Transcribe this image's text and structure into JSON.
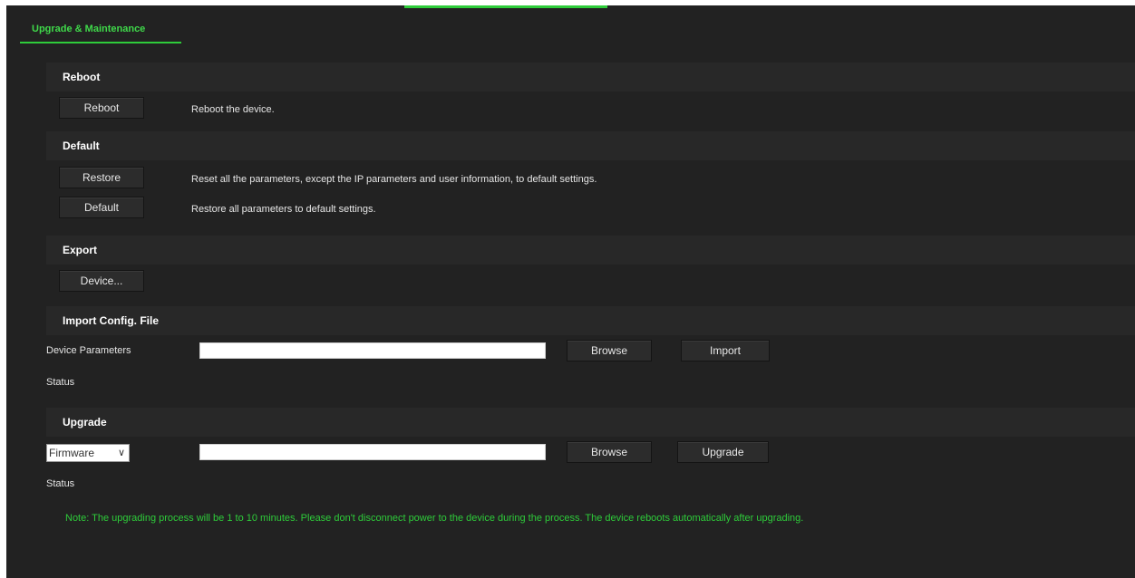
{
  "tab": {
    "label": "Upgrade & Maintenance"
  },
  "reboot": {
    "title": "Reboot",
    "button": "Reboot",
    "description": "Reboot the device."
  },
  "default": {
    "title": "Default",
    "restore_button": "Restore",
    "restore_description": "Reset all the parameters, except the IP parameters and user information, to default settings.",
    "default_button": "Default",
    "default_description": "Restore all parameters to default settings."
  },
  "export": {
    "title": "Export",
    "device_button": "Device..."
  },
  "import": {
    "title": "Import Config. File",
    "label": "Device Parameters",
    "file_value": "",
    "browse_button": "Browse",
    "import_button": "Import",
    "status_label": "Status"
  },
  "upgrade": {
    "title": "Upgrade",
    "type_selected": "Firmware",
    "file_value": "",
    "browse_button": "Browse",
    "upgrade_button": "Upgrade",
    "status_label": "Status",
    "note": "Note: The upgrading process will be 1 to 10 minutes. Please don't disconnect power to the device during the process. The device reboots automatically after upgrading."
  },
  "colors": {
    "background": "#222222",
    "accent": "#2ecc3a",
    "section_bar": "#282828"
  }
}
